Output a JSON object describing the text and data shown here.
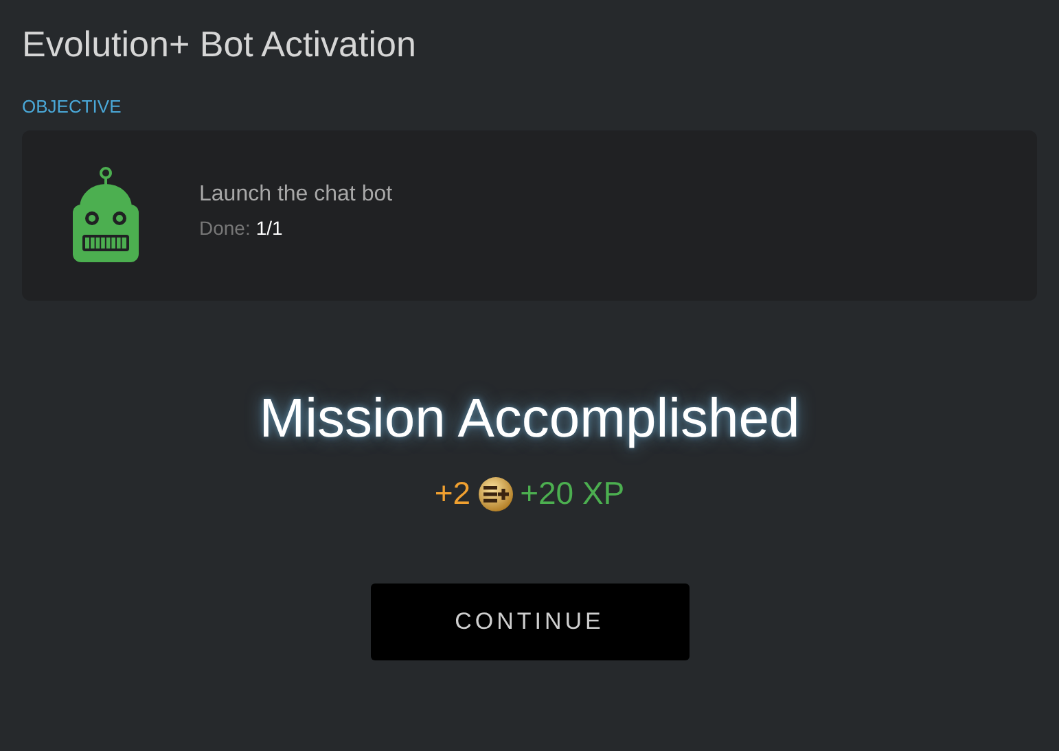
{
  "title": "Evolution+ Bot Activation",
  "objective": {
    "label": "OBJECTIVE",
    "task": "Launch the chat bot",
    "done_label": "Done:",
    "done_value": "1/1"
  },
  "result": {
    "heading": "Mission Accomplished",
    "coins": "+2",
    "xp": "+20 XP"
  },
  "buttons": [
    "CONTINUE"
  ]
}
